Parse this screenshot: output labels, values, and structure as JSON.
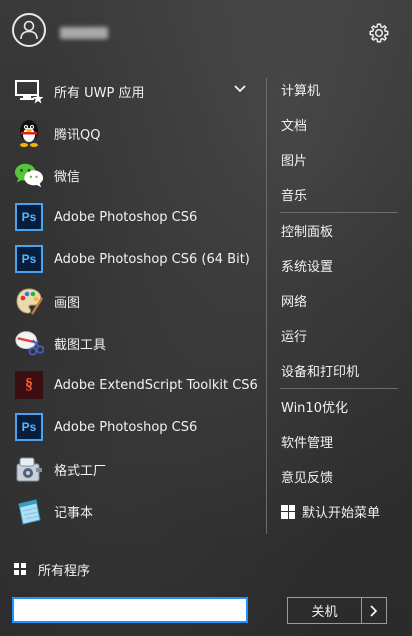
{
  "header": {
    "avatar_icon": "user-icon",
    "settings_icon": "gear-icon"
  },
  "apps": [
    {
      "label": "所有 UWP 应用",
      "icon": "uwp-apps-icon",
      "has_chevron": true
    },
    {
      "label": "腾讯QQ",
      "icon": "qq-penguin-icon"
    },
    {
      "label": "微信",
      "icon": "wechat-icon"
    },
    {
      "label": "Adobe Photoshop CS6",
      "icon": "photoshop-icon",
      "icon_text": "Ps"
    },
    {
      "label": "Adobe Photoshop CS6 (64 Bit)",
      "icon": "photoshop-icon",
      "icon_text": "Ps"
    },
    {
      "label": "画图",
      "icon": "paint-palette-icon"
    },
    {
      "label": "截图工具",
      "icon": "snipping-tool-icon"
    },
    {
      "label": "Adobe ExtendScript Toolkit CS6",
      "icon": "extendscript-icon"
    },
    {
      "label": "Adobe Photoshop CS6",
      "icon": "photoshop-icon",
      "icon_text": "Ps"
    },
    {
      "label": "格式工厂",
      "icon": "format-factory-icon"
    },
    {
      "label": "记事本",
      "icon": "notepad-icon"
    }
  ],
  "right_menu": {
    "group1": [
      "计算机",
      "文档",
      "图片",
      "音乐"
    ],
    "group2": [
      "控制面板",
      "系统设置",
      "网络",
      "运行",
      "设备和打印机"
    ],
    "group3": [
      "Win10优化",
      "软件管理",
      "意见反馈",
      "默认开始菜单"
    ]
  },
  "all_programs_label": "所有程序",
  "search": {
    "value": "",
    "placeholder": ""
  },
  "shutdown_label": "关机",
  "colors": {
    "accent": "#1e90ff",
    "background": "#2b2b2b",
    "text": "#f2f2f2"
  }
}
